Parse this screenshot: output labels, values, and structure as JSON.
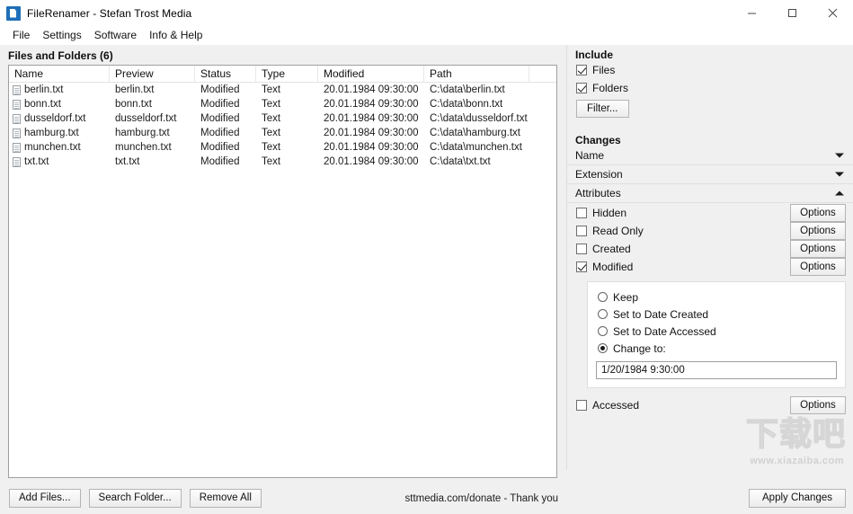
{
  "window": {
    "title": "FileRenamer - Stefan Trost Media",
    "icon": "app-document-icon",
    "controls": {
      "minimize": "minimize-icon",
      "maximize": "maximize-icon",
      "close": "close-icon"
    }
  },
  "menubar": {
    "items": [
      {
        "label": "File"
      },
      {
        "label": "Settings"
      },
      {
        "label": "Software"
      },
      {
        "label": "Info & Help"
      }
    ]
  },
  "files_panel": {
    "title": "Files and Folders (6)",
    "columns": [
      "Name",
      "Preview",
      "Status",
      "Type",
      "Modified",
      "Path"
    ],
    "rows": [
      {
        "name": "berlin.txt",
        "preview": "berlin.txt",
        "status": "Modified",
        "type": "Text",
        "modified": "20.01.1984 09:30:00",
        "path": "C:\\data\\berlin.txt"
      },
      {
        "name": "bonn.txt",
        "preview": "bonn.txt",
        "status": "Modified",
        "type": "Text",
        "modified": "20.01.1984 09:30:00",
        "path": "C:\\data\\bonn.txt"
      },
      {
        "name": "dusseldorf.txt",
        "preview": "dusseldorf.txt",
        "status": "Modified",
        "type": "Text",
        "modified": "20.01.1984 09:30:00",
        "path": "C:\\data\\dusseldorf.txt"
      },
      {
        "name": "hamburg.txt",
        "preview": "hamburg.txt",
        "status": "Modified",
        "type": "Text",
        "modified": "20.01.1984 09:30:00",
        "path": "C:\\data\\hamburg.txt"
      },
      {
        "name": "munchen.txt",
        "preview": "munchen.txt",
        "status": "Modified",
        "type": "Text",
        "modified": "20.01.1984 09:30:00",
        "path": "C:\\data\\munchen.txt"
      },
      {
        "name": "txt.txt",
        "preview": "txt.txt",
        "status": "Modified",
        "type": "Text",
        "modified": "20.01.1984 09:30:00",
        "path": "C:\\data\\txt.txt"
      }
    ]
  },
  "bottom_toolbar": {
    "add_files": "Add Files...",
    "search_folder": "Search Folder...",
    "remove_all": "Remove All",
    "donate_text": "sttmedia.com/donate - Thank you"
  },
  "include": {
    "title": "Include",
    "files": {
      "label": "Files",
      "checked": true
    },
    "folders": {
      "label": "Folders",
      "checked": true
    },
    "filter_button": "Filter..."
  },
  "changes": {
    "title": "Changes",
    "sections": [
      {
        "label": "Name",
        "expanded": false
      },
      {
        "label": "Extension",
        "expanded": false
      },
      {
        "label": "Attributes",
        "expanded": true
      }
    ]
  },
  "attributes": {
    "rows": [
      {
        "label": "Hidden",
        "checked": false,
        "options": "Options"
      },
      {
        "label": "Read Only",
        "checked": false,
        "options": "Options"
      },
      {
        "label": "Created",
        "checked": false,
        "options": "Options"
      },
      {
        "label": "Modified",
        "checked": true,
        "options": "Options"
      }
    ],
    "accessed": {
      "label": "Accessed",
      "checked": false,
      "options": "Options"
    },
    "modified_panel": {
      "radios": [
        {
          "label": "Keep",
          "selected": false
        },
        {
          "label": "Set to Date Created",
          "selected": false
        },
        {
          "label": "Set to Date Accessed",
          "selected": false
        },
        {
          "label": "Change to:",
          "selected": true
        }
      ],
      "date_value": "1/20/1984 9:30:00"
    }
  },
  "apply": {
    "label": "Apply Changes"
  },
  "watermark": {
    "logo": "下载吧",
    "url": "www.xiazaiba.com"
  }
}
